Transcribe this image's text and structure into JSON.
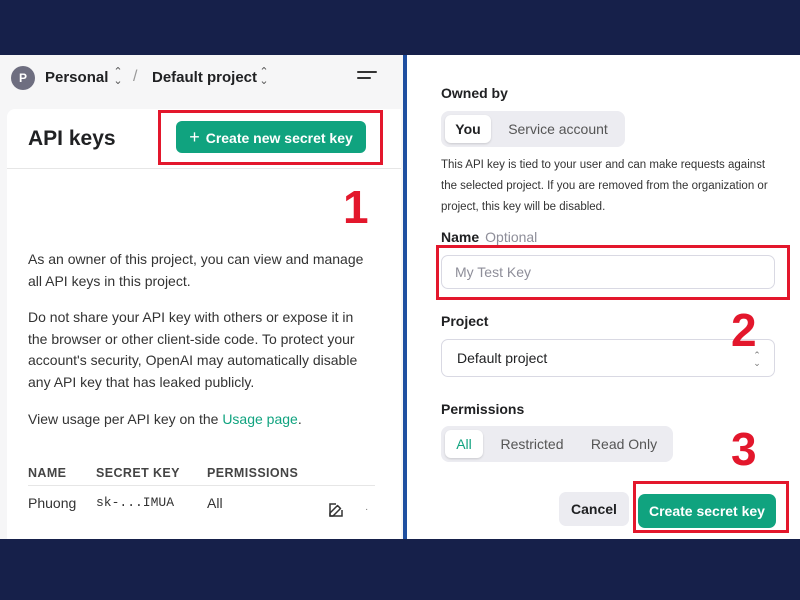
{
  "topbar": {
    "avatar_initial": "P",
    "org": "Personal",
    "separator": "/",
    "project": "Default project"
  },
  "left": {
    "title": "API keys",
    "create_button": "Create new secret key",
    "create_button_icon": "+",
    "para1": "As an owner of this project, you can view and manage all API keys in this project.",
    "para2": "Do not share your API key with others or expose it in the browser or other client-side code. To protect your account's security, OpenAI may automatically disable any API key that has leaked publicly.",
    "para3_prefix": "View usage per API key on the ",
    "para3_link": "Usage page",
    "para3_suffix": ".",
    "table": {
      "headers": [
        "NAME",
        "SECRET KEY",
        "PERMISSIONS"
      ],
      "rows": [
        {
          "name": "Phuong",
          "secret_key": "sk-...IMUA",
          "permissions": "All"
        }
      ]
    }
  },
  "right": {
    "owned_by_label": "Owned by",
    "owned_by_options": [
      "You",
      "Service account"
    ],
    "owned_by_selected": "You",
    "help_text": "This API key is tied to your user and can make requests against the selected project. If you are removed from the organization or project, this key will be disabled.",
    "name_label": "Name",
    "name_optional": "Optional",
    "name_placeholder": "My Test Key",
    "project_label": "Project",
    "project_value": "Default project",
    "permissions_label": "Permissions",
    "permissions_options": [
      "All",
      "Restricted",
      "Read Only"
    ],
    "permissions_selected": "All",
    "cancel_button": "Cancel",
    "create_button": "Create secret key"
  },
  "annotations": {
    "step1": "1",
    "step2": "2",
    "step3": "3"
  },
  "colors": {
    "accent_green": "#10a37f",
    "highlight_red": "#e3172c",
    "frame_navy": "#16204a"
  },
  "icons": {
    "menu": "menu-icon",
    "edit": "edit-icon",
    "chevron": "chevron-updown-icon"
  }
}
